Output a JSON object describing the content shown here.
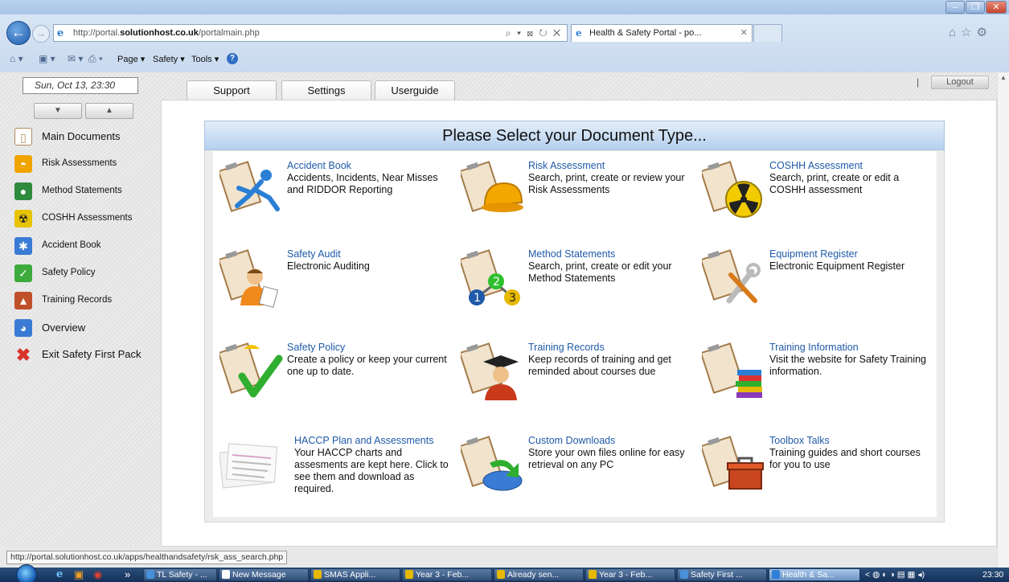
{
  "browser": {
    "url_prefix": "http://portal.",
    "url_domain": "solutionhost.co.uk",
    "url_path": "/portalmain.php",
    "address_actions": "⌕ ▾ ⊠ ↻ ✕",
    "tab_title": "Health & Safety Portal - po...",
    "tab_close": "✕",
    "window_min": "–",
    "window_max": "❐",
    "window_close": "✕",
    "right_icons": "⌂☆⚙",
    "commands": [
      "Page ▾",
      "Safety ▾",
      "Tools ▾"
    ],
    "help_icon": "?",
    "status_url": "http://portal.solutionhost.co.uk/apps/healthandsafety/rsk_ass_search.php"
  },
  "sidebar": {
    "date": "Sun, Oct 13, 23:30",
    "arrow_down": "▼",
    "arrow_up": "▲",
    "items": [
      {
        "label": "Main Documents",
        "icon": "document-icon",
        "color": "#ffffff"
      },
      {
        "label": "Risk Assessments",
        "icon": "hard-hat-icon",
        "color": "#f0a400"
      },
      {
        "label": "Method Statements",
        "icon": "steps-icon",
        "color": "#2e8b3e"
      },
      {
        "label": "COSHH Assessments",
        "icon": "hazard-icon",
        "color": "#e7c300"
      },
      {
        "label": "Accident Book",
        "icon": "accident-icon",
        "color": "#3a7bd5"
      },
      {
        "label": "Safety Policy",
        "icon": "checkmark-icon",
        "color": "#3cab3c"
      },
      {
        "label": "Training Records",
        "icon": "graduate-icon",
        "color": "#c0502a"
      },
      {
        "label": "Overview",
        "icon": "pie-chart-icon",
        "color": "#3a7bd5"
      },
      {
        "label": "Exit Safety First Pack",
        "icon": "exit-icon",
        "color": "#d9342b"
      }
    ]
  },
  "toptabs": [
    "Support",
    "Settings",
    "Userguide"
  ],
  "logout_sep": "|",
  "logout_label": "Logout",
  "panel": {
    "heading": "Please Select your Document Type...",
    "cards": [
      {
        "title": "Accident Book",
        "desc": "Accidents, Incidents, Near Misses and RIDDOR Reporting",
        "icon": "accident-book-icon"
      },
      {
        "title": "Risk Assessment",
        "desc": "Search, print, create or review your Risk Assessments",
        "icon": "risk-assessment-icon"
      },
      {
        "title": "COSHH Assessment",
        "desc": "Search, print, create or edit a COSHH assessment",
        "icon": "coshh-icon"
      },
      {
        "title": "Safety Audit",
        "desc": "Electronic Auditing",
        "icon": "safety-audit-icon"
      },
      {
        "title": "Method Statements",
        "desc": "Search, print, create or edit your Method Statements",
        "icon": "method-statements-icon"
      },
      {
        "title": "Equipment Register",
        "desc": "Electronic Equipment Register",
        "icon": "equipment-register-icon"
      },
      {
        "title": "Safety Policy",
        "desc": "Create a policy or keep your current one up to date.",
        "icon": "safety-policy-icon"
      },
      {
        "title": "Training Records",
        "desc": "Keep records of training and get reminded about courses due",
        "icon": "training-records-icon"
      },
      {
        "title": "Training Information",
        "desc": "Visit the website for Safety Training information.",
        "icon": "training-information-icon"
      },
      {
        "title": "HACCP Plan and Assessments",
        "desc": "Your HACCP charts and assesments are kept here. Click to see them and download as required.",
        "icon": "haccp-icon"
      },
      {
        "title": "Custom Downloads",
        "desc": "Store your own files online for easy retrieval on any PC",
        "icon": "custom-downloads-icon"
      },
      {
        "title": "Toolbox Talks",
        "desc": "Training guides and short courses for you to use",
        "icon": "toolbox-talks-icon"
      }
    ]
  },
  "taskbar": {
    "items": [
      {
        "label": "TL Safety - ...",
        "color": "#4a90d9"
      },
      {
        "label": "New Message",
        "color": "#ffffff"
      },
      {
        "label": "SMAS Appli...",
        "color": "#e6b800"
      },
      {
        "label": "Year 3 - Feb...",
        "color": "#e6b800"
      },
      {
        "label": "Already sen...",
        "color": "#e6b800"
      },
      {
        "label": "Year 3 - Feb...",
        "color": "#e6b800"
      },
      {
        "label": "Safety First ...",
        "color": "#4a90d9"
      },
      {
        "label": "Health & Sa...",
        "color": "#2f7fd6"
      }
    ],
    "pinned_more": "»",
    "tray_arrow": "<",
    "clock": "23:30"
  }
}
